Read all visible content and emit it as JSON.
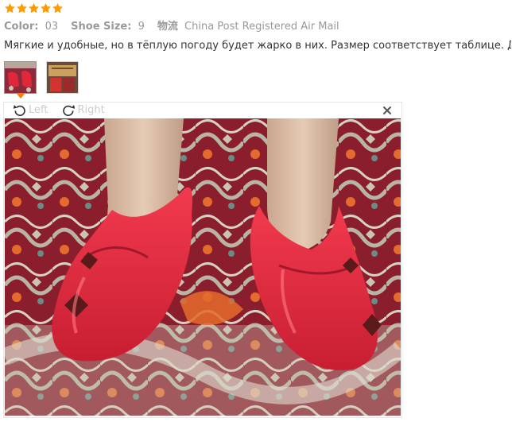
{
  "review": {
    "rating": 5,
    "star_color": "#ff9a00",
    "attributes": [
      {
        "label": "Color:",
        "value": "03"
      },
      {
        "label": "Shoe Size:",
        "value": "9"
      },
      {
        "label": "物流",
        "value": "China Post Registered Air Mail"
      }
    ],
    "text": "Мягкие и удобные, но в тёплую погоду будет жарко в них. Размер соответствует таблице. Довольна!",
    "thumbnails": [
      {
        "icon": "photo-red-shoes-thumbnail",
        "selected": true
      },
      {
        "icon": "photo-shoes-box-thumbnail",
        "selected": false
      }
    ]
  },
  "viewer": {
    "rotate_left_label": "Left",
    "rotate_right_label": "Right",
    "close_icon": "close-icon",
    "accent_color": "#ff7a00"
  }
}
